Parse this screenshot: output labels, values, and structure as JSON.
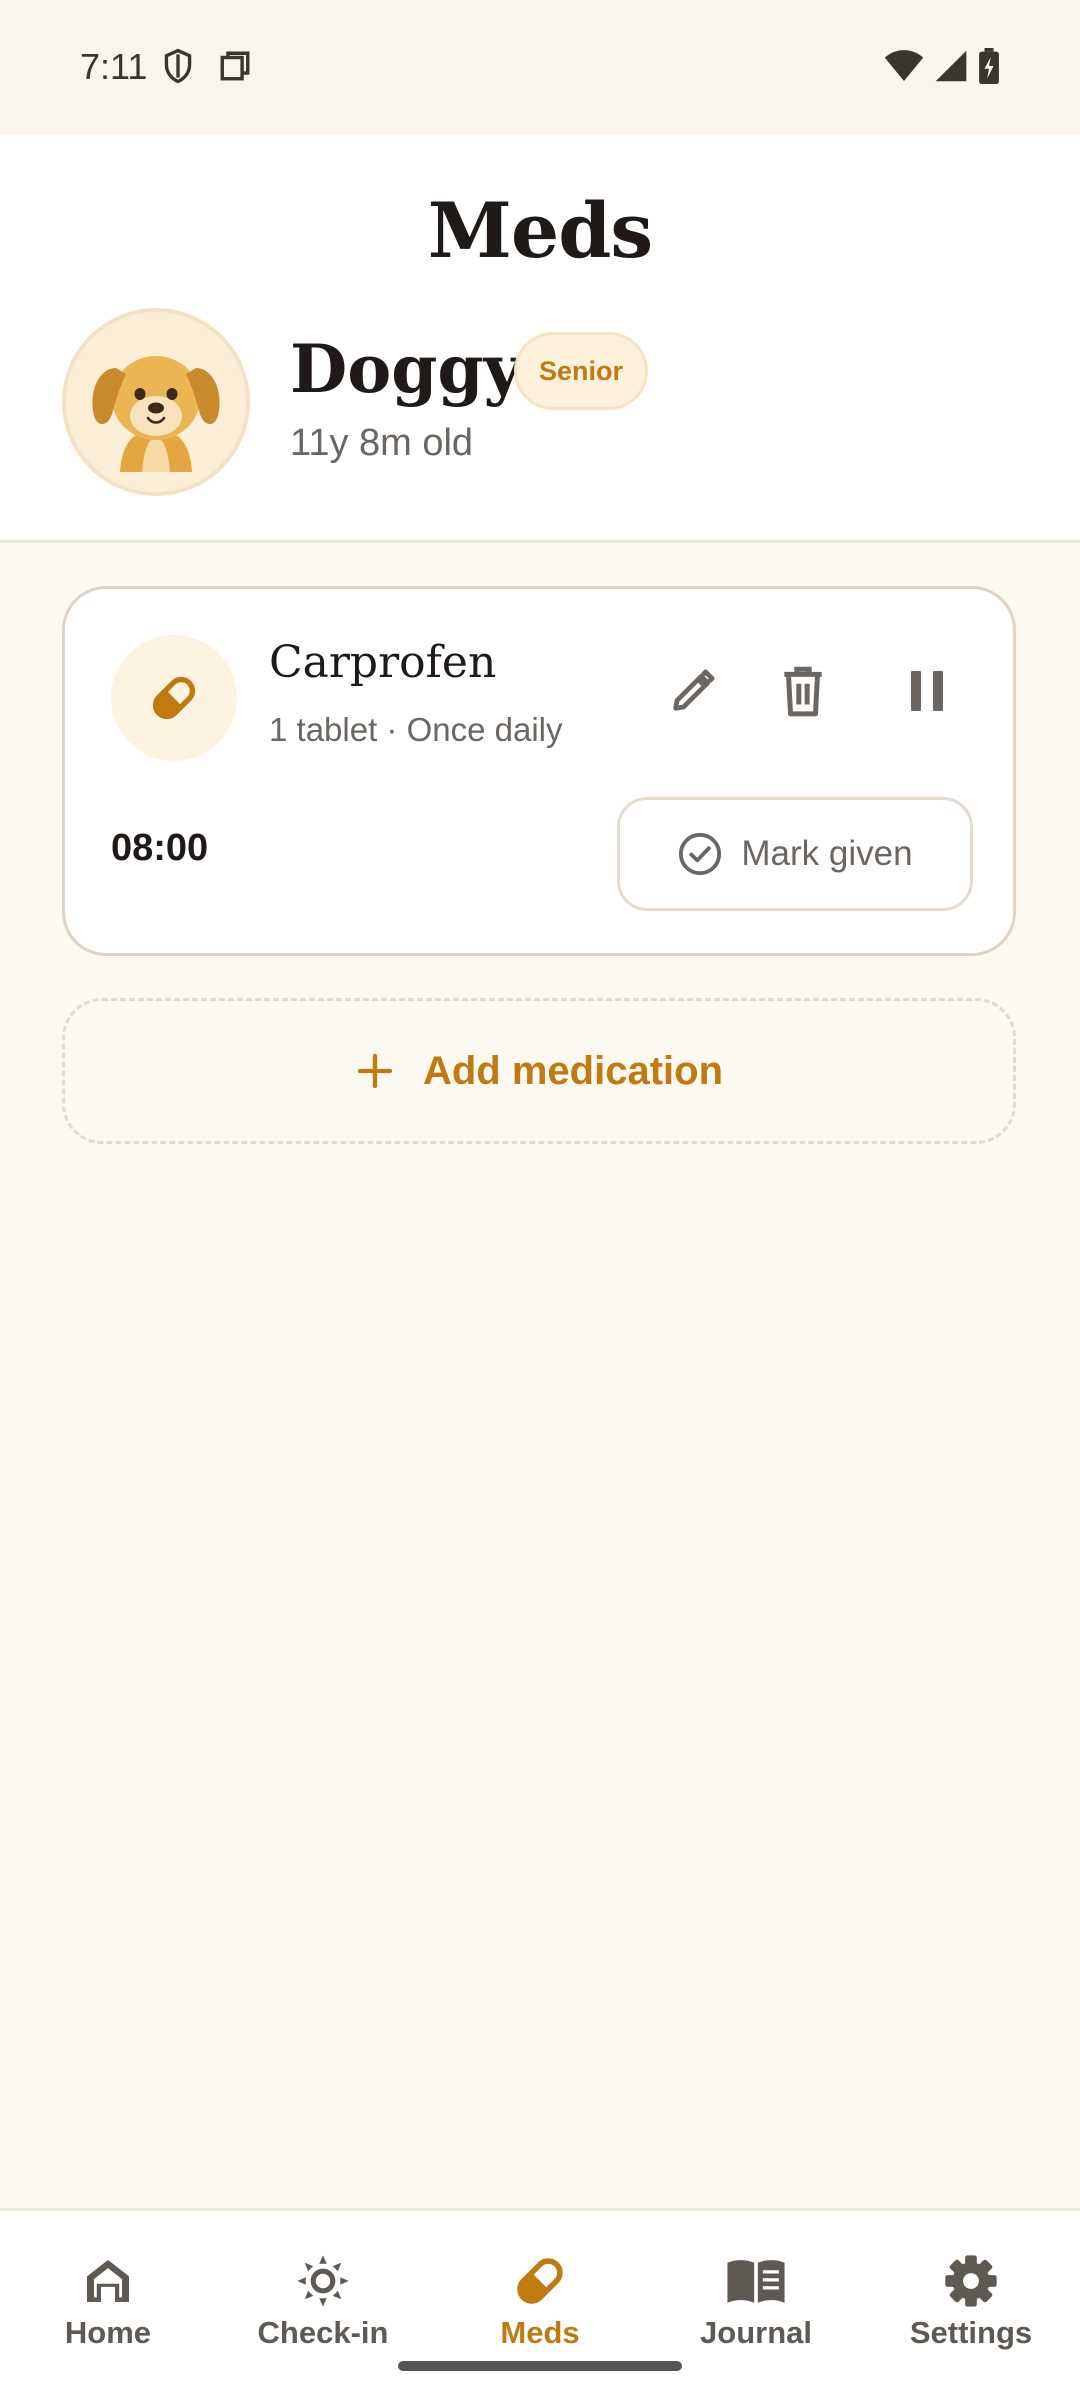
{
  "status_bar": {
    "time": "7:11"
  },
  "header": {
    "title": "Meds",
    "pet": {
      "name": "Doggy",
      "badge": "Senior",
      "age": "11y 8m old"
    }
  },
  "medications": [
    {
      "name": "Carprofen",
      "detail": "1 tablet · Once daily",
      "time": "08:00",
      "mark_label": "Mark given"
    }
  ],
  "add_label": "Add medication",
  "nav": [
    {
      "label": "Home",
      "icon": "home-icon",
      "active": false
    },
    {
      "label": "Check-in",
      "icon": "sun-icon",
      "active": false
    },
    {
      "label": "Meds",
      "icon": "pill-icon",
      "active": true
    },
    {
      "label": "Journal",
      "icon": "book-icon",
      "active": false
    },
    {
      "label": "Settings",
      "icon": "gear-icon",
      "active": false
    }
  ],
  "colors": {
    "accent": "#c07a10",
    "background": "#fcf8f2",
    "text_muted": "#6b6661"
  }
}
